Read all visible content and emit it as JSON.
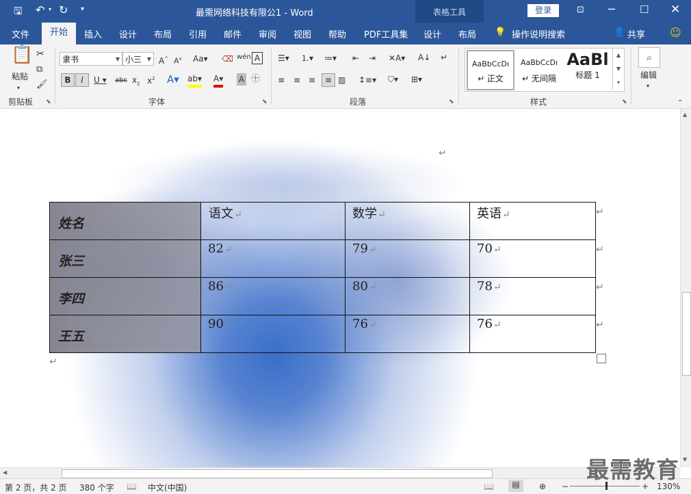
{
  "titlebar": {
    "title": "最需网络科技有限公1 - Word",
    "context_tools": "表格工具",
    "login": "登录"
  },
  "tabs": [
    "文件",
    "开始",
    "插入",
    "设计",
    "布局",
    "引用",
    "邮件",
    "审阅",
    "视图",
    "帮助",
    "PDF工具集",
    "设计",
    "布局"
  ],
  "tellme": "操作说明搜索",
  "share": "共享",
  "ribbon": {
    "clipboard": {
      "paste": "粘贴",
      "label": "剪贴板"
    },
    "font": {
      "name": "隶书",
      "size": "小三",
      "label": "字体"
    },
    "paragraph": {
      "label": "段落"
    },
    "styles": {
      "label": "样式",
      "items": [
        {
          "preview": "AaBbCcDı",
          "name": "↵ 正文"
        },
        {
          "preview": "AaBbCcDı",
          "name": "↵ 无间隔"
        },
        {
          "preview": "AaBl",
          "name": "标题 1"
        }
      ]
    },
    "editing": {
      "label": "编辑"
    }
  },
  "table": {
    "header": [
      "姓名",
      "语文",
      "数学",
      "英语"
    ],
    "rows": [
      [
        "张三",
        "82",
        "79",
        "70"
      ],
      [
        "李四",
        "86",
        "80",
        "78"
      ],
      [
        "王五",
        "90",
        "76",
        "76"
      ]
    ]
  },
  "para_mark": "↵",
  "status": {
    "page": "第 2 页，共 2 页",
    "words": "380 个字",
    "lang": "中文(中国)",
    "zoom": "130%"
  },
  "watermark": "最需教育"
}
